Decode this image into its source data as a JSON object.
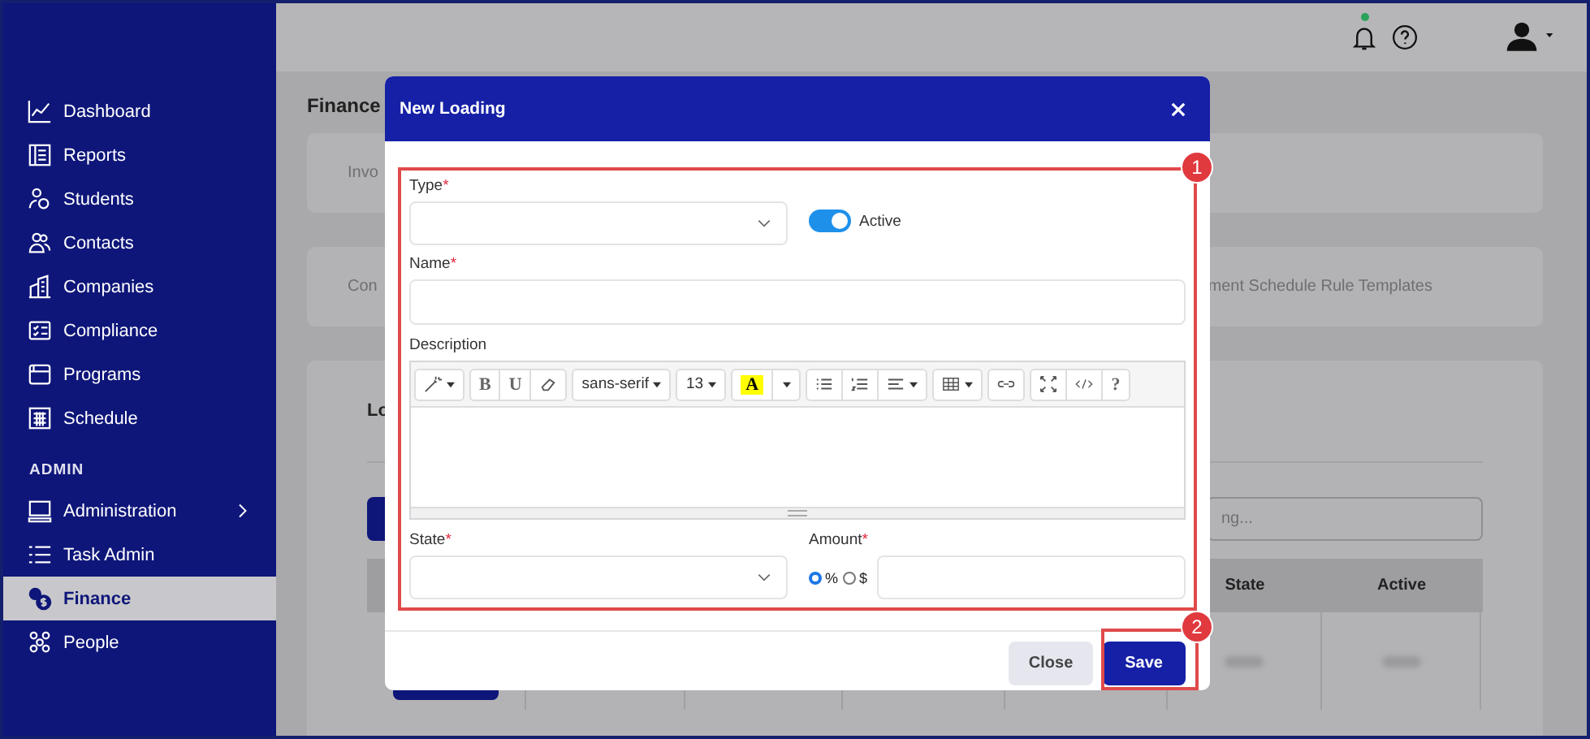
{
  "sidebar": {
    "sections": [
      {
        "items": [
          {
            "label": "Dashboard",
            "selected": false
          },
          {
            "label": "Reports",
            "selected": false
          },
          {
            "label": "Students",
            "selected": false
          },
          {
            "label": "Contacts",
            "selected": false
          },
          {
            "label": "Companies",
            "selected": false
          },
          {
            "label": "Compliance",
            "selected": false
          },
          {
            "label": "Programs",
            "selected": false
          },
          {
            "label": "Schedule",
            "selected": false
          }
        ]
      },
      {
        "heading": "ADMIN",
        "items": [
          {
            "label": "Administration",
            "selected": false,
            "expandable": true
          },
          {
            "label": "Task Admin",
            "selected": false
          },
          {
            "label": "Finance",
            "selected": true
          },
          {
            "label": "People",
            "selected": false
          }
        ]
      }
    ]
  },
  "topbar": {
    "has_notification": true
  },
  "page": {
    "title": "Finance",
    "cards": [
      {
        "left_text": "Invo"
      },
      {
        "left_text": "Con",
        "right_text": "ment Schedule Rule Templates"
      }
    ],
    "panel": {
      "heading": "Lo",
      "search": {
        "placeholder": "ng..."
      },
      "table": {
        "columns": [
          "State",
          "Active"
        ],
        "rows": [
          {
            "kind": "blurred"
          }
        ]
      }
    }
  },
  "dialog": {
    "title": "New Loading",
    "type": {
      "label": "Type",
      "required_mark": "*"
    },
    "active": {
      "label": "Active",
      "on": true
    },
    "name": {
      "label": "Name",
      "required_mark": "*"
    },
    "description": {
      "label": "Description",
      "toolbar": [
        [
          {
            "kind": "magic",
            "dropdown": true
          }
        ],
        [
          {
            "kind": "text",
            "label": "B"
          },
          {
            "kind": "text",
            "label": "U"
          },
          {
            "kind": "eraser"
          }
        ],
        [
          {
            "kind": "text",
            "label": "sans-serif",
            "dropdown": true
          }
        ],
        [
          {
            "kind": "text",
            "label": "13",
            "dropdown": true
          }
        ],
        [
          {
            "kind": "highlight",
            "label": "A"
          },
          {
            "kind": "caret"
          }
        ],
        [
          {
            "kind": "bullets"
          },
          {
            "kind": "numbers"
          },
          {
            "kind": "align",
            "dropdown": true
          }
        ],
        [
          {
            "kind": "table",
            "dropdown": true
          }
        ],
        [
          {
            "kind": "link"
          }
        ],
        [
          {
            "kind": "fullscreen"
          },
          {
            "kind": "code"
          },
          {
            "kind": "text",
            "label": "?"
          }
        ]
      ]
    },
    "state": {
      "label": "State",
      "required_mark": "*"
    },
    "amount": {
      "label": "Amount",
      "required_mark": "*",
      "units": [
        {
          "label": "%",
          "selected": true
        },
        {
          "label": "$",
          "selected": false
        }
      ]
    },
    "buttons": [
      {
        "label": "Close",
        "kind": "secondary"
      },
      {
        "label": "Save",
        "kind": "primary"
      }
    ],
    "callouts": [
      "1",
      "2"
    ]
  }
}
